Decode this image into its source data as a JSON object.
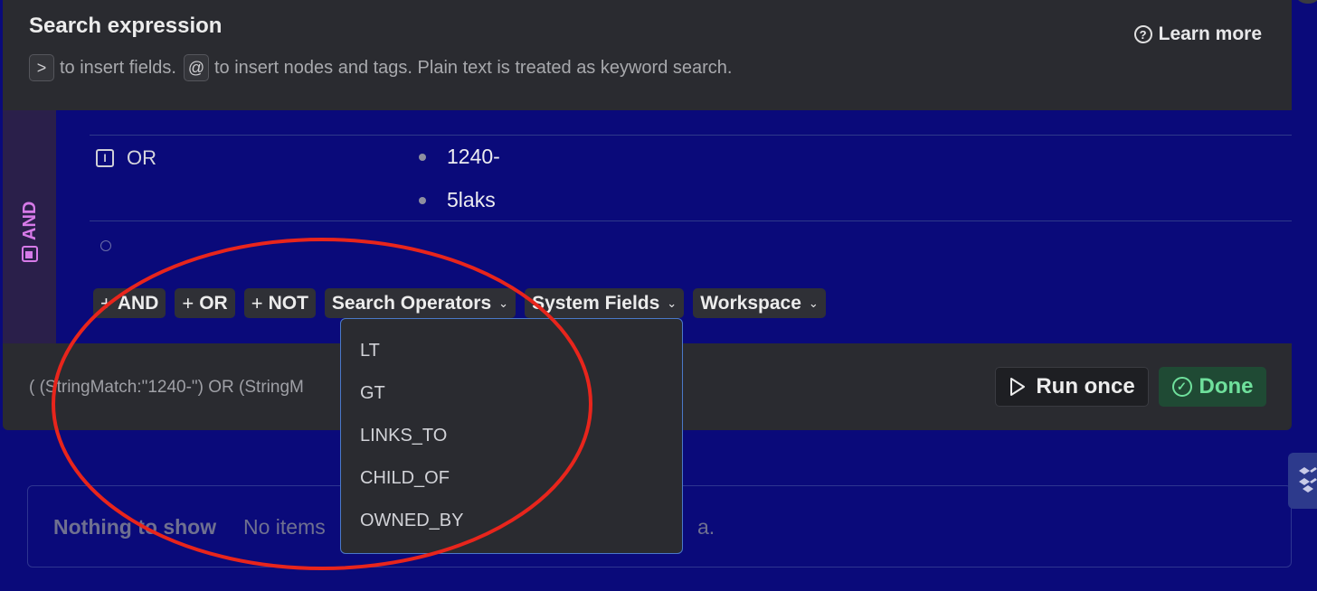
{
  "header": {
    "title": "Search expression",
    "hint_key1": ">",
    "hint_text1": "to insert fields.",
    "hint_key2": "@",
    "hint_text2": "to insert nodes and tags. Plain text is treated as keyword search.",
    "learn_more": "Learn more"
  },
  "group": {
    "label": "AND",
    "color": "#d67ae8"
  },
  "or_row": {
    "label": "OR",
    "values": [
      "1240-",
      "5laks"
    ]
  },
  "toolbar": {
    "and_label": "AND",
    "or_label": "OR",
    "not_label": "NOT",
    "plus": "+",
    "search_operators": "Search Operators",
    "system_fields": "System Fields",
    "workspace": "Workspace"
  },
  "dropdown": {
    "items": [
      "LT",
      "GT",
      "LINKS_TO",
      "CHILD_OF",
      "OWNED_BY"
    ]
  },
  "footer": {
    "query_text": "( (StringMatch:\"1240-\") OR (StringM",
    "run_once": "Run once",
    "done": "Done"
  },
  "results": {
    "title": "Nothing to show",
    "desc_visible": "No items",
    "desc_tail": "a."
  },
  "colors": {
    "background": "#0a0a7a",
    "panel": "#2a2b30",
    "done_green": "#6fe09c",
    "annotation_red": "#e8251c"
  }
}
